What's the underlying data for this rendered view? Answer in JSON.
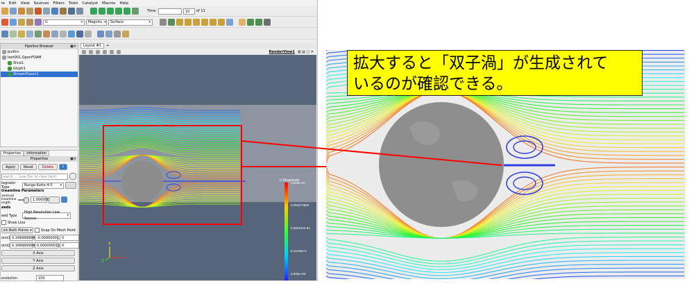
{
  "menubar": [
    "le",
    "Edit",
    "View",
    "Sources",
    "Filters",
    "Tools",
    "Catalyst",
    "Macros",
    "Help"
  ],
  "toolbar1": {
    "time_label": "Time:",
    "time_value": "10",
    "time_of": "of 11"
  },
  "toolbar2": {
    "color_by": "U",
    "component": "Magnitu",
    "representation": "Surface"
  },
  "pipeline": {
    "title": "Pipeline Browser",
    "items": [
      {
        "label": "builtin:",
        "level": 0
      },
      {
        "label": "test001.OpenFOAM",
        "level": 0
      },
      {
        "label": "Slice1",
        "level": 1
      },
      {
        "label": "Glyph1",
        "level": 1
      },
      {
        "label": "StreamTracer1",
        "level": 1,
        "selected": true
      }
    ]
  },
  "properties": {
    "tabs": [
      "Properties",
      "Information"
    ],
    "title": "Properties",
    "apply_label": "Apply",
    "reset_label": "Reset",
    "delete_label": "Delete",
    "help_label": "?",
    "search_placeholder": "earch ... (use Esc to clear text)",
    "integrator_label": "tegrator Type",
    "integrator_value": "Runge-Kutta 4-5",
    "section_streamline": "treamline Parameters",
    "max_length_label": "aximum treamline ength",
    "max_length_value": "1.000000",
    "section_seeds": "eeds",
    "seed_type_label": "eed Type",
    "seed_type_value": "High Resolution Line Source",
    "show_line_label": "Show Line",
    "pick_points_label": "ick Both Points",
    "snap_label": "Snap On Mesh Point",
    "point1_label": "oint1",
    "point1": [
      "0.349999994",
      "-0.00000001",
      "0"
    ],
    "point2_label": "oint2",
    "point2": [
      "0.349999994",
      "0.000000011",
      "0"
    ],
    "x_axis": "X Axis",
    "y_axis": "Y Axis",
    "z_axis": "Z Axis",
    "resolution_label": "esolution",
    "resolution_value": "100"
  },
  "viewport": {
    "layout_tab": "Layout #1",
    "render_view_label": "RenderView1",
    "legend": {
      "title": "U Magnitude",
      "ticks": [
        "3.649e-04",
        "0.000273860",
        "0.000182e-04",
        "9.12196e-5",
        "0.000e+00"
      ]
    },
    "axes": {
      "x": "X",
      "y": "Y",
      "z": "Z"
    }
  },
  "overlay": {
    "line1": "拡大すると「双子渦」が生成されて",
    "line2": "いるのが確認できる。"
  },
  "colors": {
    "highlight_red": "#ff0000",
    "note_yellow": "#ffff00",
    "selection_blue": "#3072d2",
    "sphere_gray": "#8e8e8e"
  }
}
